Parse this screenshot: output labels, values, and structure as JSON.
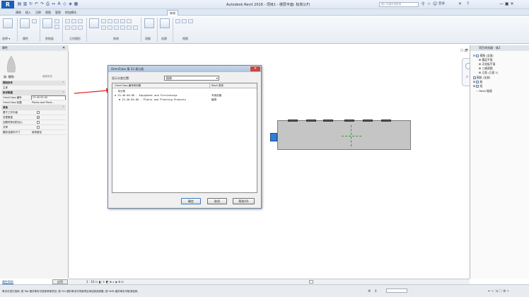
{
  "titlebar": {
    "title": "Autodesk Revit 2016 - 项目1 - 楼层平面: 标高1(F)",
    "search_placeholder": "键入关键字或短语",
    "signin": "登录",
    "window_controls": "—  ▣  ✕",
    "qat_icons": [
      "open-icon",
      "save-icon",
      "sync-icon",
      "undo-icon",
      "redo-icon",
      "print-icon",
      "measure-icon",
      "text-icon",
      "3d-view-icon",
      "section-icon",
      "close-views-icon"
    ]
  },
  "ribbon": {
    "tabs": [
      "建筑",
      "插入",
      "注释",
      "视图",
      "管理",
      "附加模块",
      "修改"
    ],
    "active_tab": "修改",
    "panels": [
      "选择",
      "属性",
      "剪贴板",
      "几何图形",
      "修改",
      "测量",
      "创建",
      "视图"
    ],
    "select_label": "选择 ▾"
  },
  "properties": {
    "header": "属性",
    "type_name": "族: 植物",
    "edit_type": "编辑类型",
    "rows": [
      {
        "group": true,
        "label": "限制条件"
      },
      {
        "label": "主体",
        "value": ""
      },
      {
        "group": true,
        "label": "标识数据"
      },
      {
        "label": "OmniClass 编号",
        "value": "23.40.05.00",
        "boxed": true
      },
      {
        "label": "OmniClass 标题",
        "value": "Plants and Plant..."
      },
      {
        "group": true,
        "label": "其他"
      },
      {
        "label": "基于工作平面",
        "check": ""
      },
      {
        "label": "总是垂直",
        "check": "✓"
      },
      {
        "label": "加载时剪切的空心",
        "check": ""
      },
      {
        "label": "共享",
        "check": ""
      },
      {
        "label": "圆形连接件尺寸",
        "value": "使用直径"
      }
    ],
    "help_link": "属性帮助",
    "apply": "应用"
  },
  "browser": {
    "header": "项目浏览器 - 族1",
    "items": [
      {
        "level": 0,
        "label": "视图 (全部)"
      },
      {
        "level": 1,
        "label": "楼层平面"
      },
      {
        "level": 1,
        "label": "天花板平面"
      },
      {
        "level": 1,
        "label": "三维视图"
      },
      {
        "level": 1,
        "label": "立面 (立面 1)"
      },
      {
        "level": 0,
        "label": "图纸 (全部)"
      },
      {
        "level": 0,
        "label": "族"
      },
      {
        "level": 0,
        "label": "组"
      },
      {
        "level": 0,
        "label": "Revit 链接"
      }
    ]
  },
  "dialog": {
    "title": "OmniClass 第 23 表分类",
    "filter_label": "显示分类位置:",
    "filter_value": "植物",
    "columns": [
      "OmniClass 编号和标题",
      "Revit 类别"
    ],
    "rows": [
      {
        "indent": 0,
        "text": "- 未分类",
        "category": ""
      },
      {
        "indent": 1,
        "text": "⊟ 23.40.00.00 - Equipment and Furnishings",
        "category": "专用设备"
      },
      {
        "indent": 2,
        "text": "⊞ 23.40.05.00 - Plants and Planting Products",
        "category": "植物"
      }
    ],
    "ok": "确定",
    "cancel": "取消",
    "help": "帮助(H)"
  },
  "canvas": {
    "view_controls": "1 : 10   ☐ ◧ ☼ ◩ ⊕ ⌕ ◈ ♁ ⊡",
    "nav_cube": "☐ 🗗 ✕"
  },
  "status": {
    "text": "单击可进行选择; 按 Tab 键并单击可选择其他项目; 按 Ctrl 键并单击可将新项目添加到选择集; 按 Shift 键并单击可取消选择。",
    "zoom": "0"
  }
}
